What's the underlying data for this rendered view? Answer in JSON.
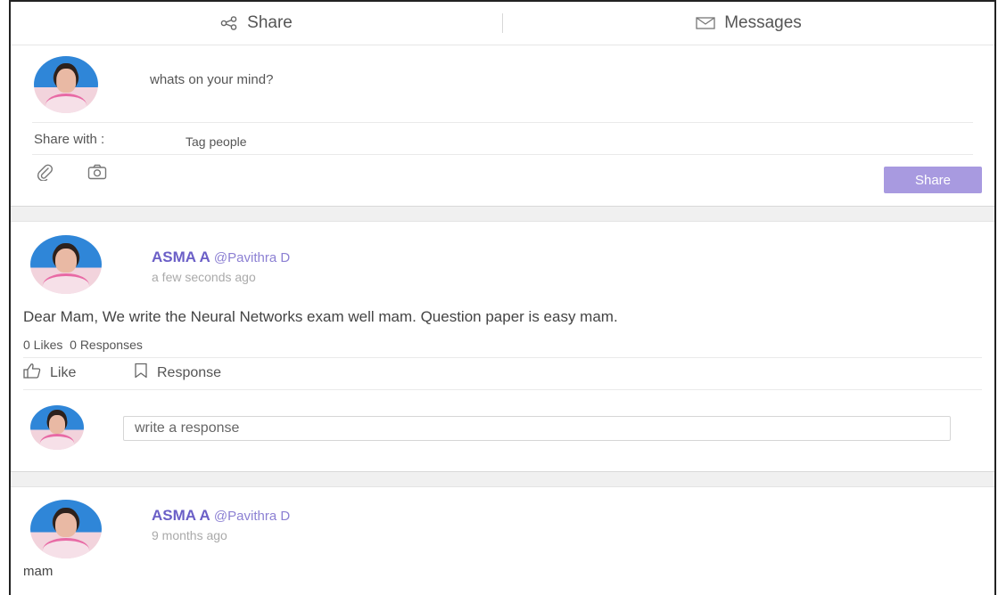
{
  "tabs": [
    {
      "label": "Share",
      "icon": "share-icon"
    },
    {
      "label": "Messages",
      "icon": "envelope-icon"
    }
  ],
  "composer": {
    "placeholder": "whats on your mind?",
    "share_with_label": "Share with :",
    "tag_people_label": "Tag people",
    "attach_icon": "paperclip-icon",
    "camera_icon": "camera-icon",
    "share_button_label": "Share"
  },
  "posts": [
    {
      "author": "ASMA A",
      "handle": "@Pavithra D",
      "time": "a few seconds ago",
      "text": "Dear Mam, We write the Neural Networks exam well mam. Question paper is easy mam.",
      "likes": "0 Likes",
      "responses": "0 Responses",
      "like_label": "Like",
      "response_label": "Response",
      "response_placeholder": "write a response"
    },
    {
      "author": "ASMA A",
      "handle": "@Pavithra D",
      "time": "9 months ago",
      "text": "mam"
    }
  ],
  "colors": {
    "accent": "#6b5fc7",
    "share_button": "#a89ae0",
    "divider": "#eaeaea"
  }
}
